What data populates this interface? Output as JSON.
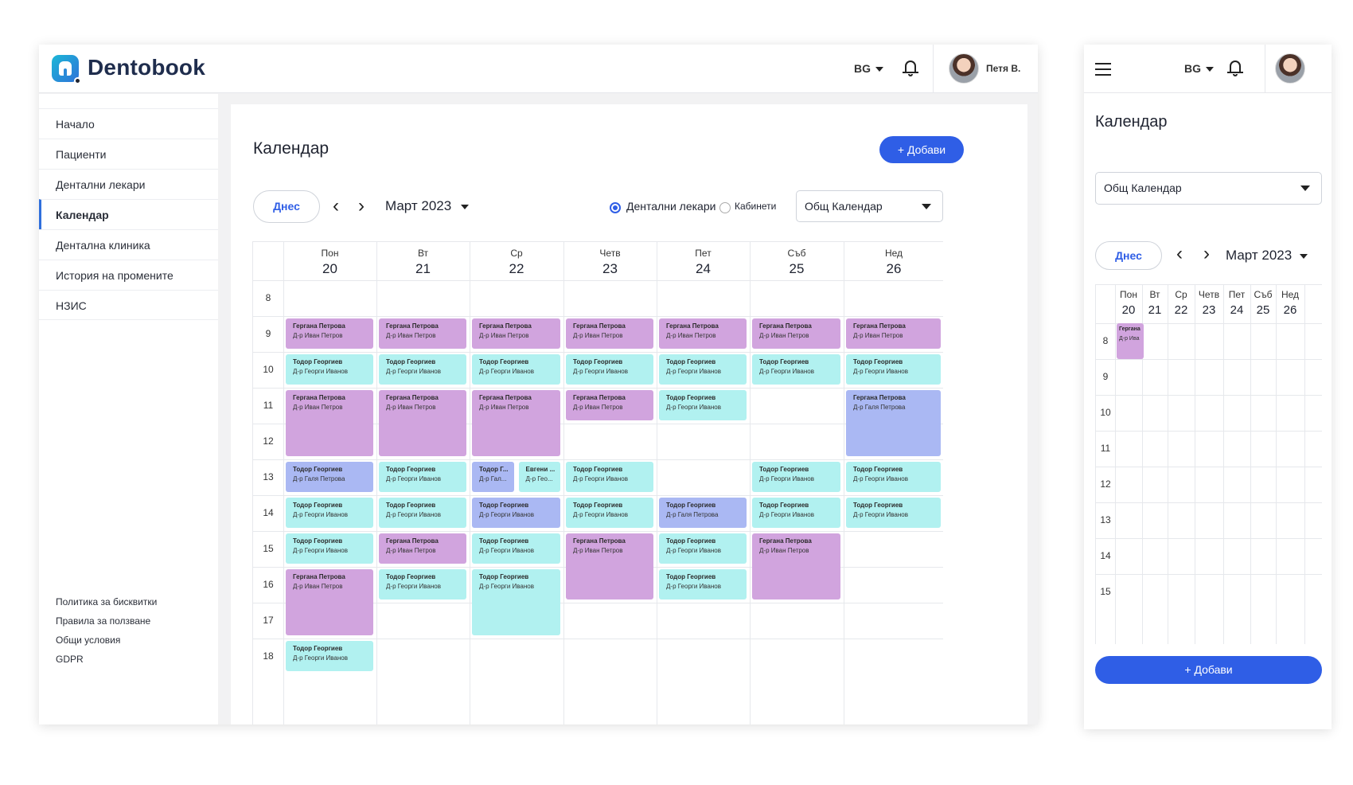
{
  "brand": {
    "name": "Dentobook",
    "accent": "#2f5ee6"
  },
  "header": {
    "lang": "BG",
    "user": "Петя В.",
    "icons": [
      "bell-icon",
      "avatar"
    ]
  },
  "sidebar": {
    "items": [
      {
        "label": "Начало"
      },
      {
        "label": "Пациенти"
      },
      {
        "label": "Дентални лекари"
      },
      {
        "label": "Календар",
        "active": true
      },
      {
        "label": "Дентална клиника"
      },
      {
        "label": "История на промените"
      },
      {
        "label": "НЗИС"
      }
    ],
    "footer": [
      "Политика за бисквитки",
      "Правила за ползване",
      "Общи условия",
      "GDPR"
    ]
  },
  "page": {
    "title": "Календар",
    "add_label": "+ Добави",
    "today_label": "Днес",
    "month": "Март 2023",
    "radio_dentists": "Дентални лекари",
    "radio_rooms": "Кабинети",
    "calendar_select": "Общ Календар"
  },
  "calendar": {
    "days": [
      {
        "name": "Пон",
        "date": "20"
      },
      {
        "name": "Вт",
        "date": "21"
      },
      {
        "name": "Ср",
        "date": "22"
      },
      {
        "name": "Четв",
        "date": "23"
      },
      {
        "name": "Пет",
        "date": "24"
      },
      {
        "name": "Съб",
        "date": "25"
      },
      {
        "name": "Нед",
        "date": "26"
      }
    ],
    "hours": [
      "8",
      "9",
      "10",
      "11",
      "12",
      "13",
      "14",
      "15",
      "16",
      "17",
      "18"
    ],
    "colors": {
      "purple": "#d1a4de",
      "cyan": "#b1f1f0",
      "blue": "#aab8f3"
    },
    "events": [
      {
        "day": 0,
        "start": 9,
        "end": 10,
        "patient": "Гергана Петрова",
        "doctor": "Д-р Иван Петров",
        "color": "purple"
      },
      {
        "day": 0,
        "start": 10,
        "end": 11,
        "patient": "Тодор Георгиев",
        "doctor": "Д-р Георги Иванов",
        "color": "cyan"
      },
      {
        "day": 0,
        "start": 11,
        "end": 13,
        "patient": "Гергана Петрова",
        "doctor": "Д-р Иван Петров",
        "color": "purple"
      },
      {
        "day": 0,
        "start": 13,
        "end": 14,
        "patient": "Тодор Георгиев",
        "doctor": "Д-р Галя Петрова",
        "color": "blue"
      },
      {
        "day": 0,
        "start": 14,
        "end": 15,
        "patient": "Тодор Георгиев",
        "doctor": "Д-р Георги Иванов",
        "color": "cyan"
      },
      {
        "day": 0,
        "start": 15,
        "end": 16,
        "patient": "Тодор Георгиев",
        "doctor": "Д-р Георги Иванов",
        "color": "cyan"
      },
      {
        "day": 0,
        "start": 16,
        "end": 18,
        "patient": "Гергана Петрова",
        "doctor": "Д-р Иван Петров",
        "color": "purple"
      },
      {
        "day": 0,
        "start": 18,
        "end": 19,
        "patient": "Тодор Георгиев",
        "doctor": "Д-р Георги Иванов",
        "color": "cyan"
      },
      {
        "day": 1,
        "start": 9,
        "end": 10,
        "patient": "Гергана Петрова",
        "doctor": "Д-р Иван Петров",
        "color": "purple"
      },
      {
        "day": 1,
        "start": 10,
        "end": 11,
        "patient": "Тодор Георгиев",
        "doctor": "Д-р Георги Иванов",
        "color": "cyan"
      },
      {
        "day": 1,
        "start": 11,
        "end": 13,
        "patient": "Гергана Петрова",
        "doctor": "Д-р Иван Петров",
        "color": "purple"
      },
      {
        "day": 1,
        "start": 13,
        "end": 14,
        "patient": "Тодор Георгиев",
        "doctor": "Д-р Георги Иванов",
        "color": "cyan"
      },
      {
        "day": 1,
        "start": 14,
        "end": 15,
        "patient": "Тодор Георгиев",
        "doctor": "Д-р Георги Иванов",
        "color": "cyan"
      },
      {
        "day": 1,
        "start": 15,
        "end": 16,
        "patient": "Гергана Петрова",
        "doctor": "Д-р Иван Петров",
        "color": "purple"
      },
      {
        "day": 1,
        "start": 16,
        "end": 17,
        "patient": "Тодор Георгиев",
        "doctor": "Д-р Георги Иванов",
        "color": "cyan"
      },
      {
        "day": 2,
        "start": 9,
        "end": 10,
        "patient": "Гергана Петрова",
        "doctor": "Д-р Иван Петров",
        "color": "purple"
      },
      {
        "day": 2,
        "start": 10,
        "end": 11,
        "patient": "Тодор Георгиев",
        "doctor": "Д-р Георги Иванов",
        "color": "cyan"
      },
      {
        "day": 2,
        "start": 11,
        "end": 13,
        "patient": "Гергана Петрова",
        "doctor": "Д-р Иван Петров",
        "color": "purple"
      },
      {
        "day": 2,
        "start": 13,
        "end": 14,
        "patient": "Тодор Г...",
        "doctor": "Д-р Гал...",
        "color": "blue",
        "half": 0
      },
      {
        "day": 2,
        "start": 13,
        "end": 14,
        "patient": "Евгени ...",
        "doctor": "Д-р Гео...",
        "color": "cyan",
        "half": 1
      },
      {
        "day": 2,
        "start": 14,
        "end": 15,
        "patient": "Тодор Георгиев",
        "doctor": "Д-р Георги Иванов",
        "color": "blue"
      },
      {
        "day": 2,
        "start": 15,
        "end": 16,
        "patient": "Тодор Георгиев",
        "doctor": "Д-р Георги Иванов",
        "color": "cyan"
      },
      {
        "day": 2,
        "start": 16,
        "end": 18,
        "patient": "Тодор Георгиев",
        "doctor": "Д-р Георги Иванов",
        "color": "cyan"
      },
      {
        "day": 3,
        "start": 9,
        "end": 10,
        "patient": "Гергана Петрова",
        "doctor": "Д-р Иван Петров",
        "color": "purple"
      },
      {
        "day": 3,
        "start": 10,
        "end": 11,
        "patient": "Тодор Георгиев",
        "doctor": "Д-р Георги Иванов",
        "color": "cyan"
      },
      {
        "day": 3,
        "start": 11,
        "end": 12,
        "patient": "Гергана Петрова",
        "doctor": "Д-р Иван Петров",
        "color": "purple"
      },
      {
        "day": 3,
        "start": 13,
        "end": 14,
        "patient": "Тодор Георгиев",
        "doctor": "Д-р Георги Иванов",
        "color": "cyan"
      },
      {
        "day": 3,
        "start": 14,
        "end": 15,
        "patient": "Тодор Георгиев",
        "doctor": "Д-р Георги Иванов",
        "color": "cyan"
      },
      {
        "day": 3,
        "start": 15,
        "end": 17,
        "patient": "Гергана Петрова",
        "doctor": "Д-р Иван Петров",
        "color": "purple"
      },
      {
        "day": 4,
        "start": 9,
        "end": 10,
        "patient": "Гергана Петрова",
        "doctor": "Д-р Иван Петров",
        "color": "purple"
      },
      {
        "day": 4,
        "start": 10,
        "end": 11,
        "patient": "Тодор Георгиев",
        "doctor": "Д-р Георги Иванов",
        "color": "cyan"
      },
      {
        "day": 4,
        "start": 11,
        "end": 12,
        "patient": "Тодор Георгиев",
        "doctor": "Д-р Георги Иванов",
        "color": "cyan"
      },
      {
        "day": 4,
        "start": 14,
        "end": 15,
        "patient": "Тодор Георгиев",
        "doctor": "Д-р Галя Петрова",
        "color": "blue"
      },
      {
        "day": 4,
        "start": 15,
        "end": 16,
        "patient": "Тодор Георгиев",
        "doctor": "Д-р Георги Иванов",
        "color": "cyan"
      },
      {
        "day": 4,
        "start": 16,
        "end": 17,
        "patient": "Тодор Георгиев",
        "doctor": "Д-р Георги Иванов",
        "color": "cyan"
      },
      {
        "day": 5,
        "start": 9,
        "end": 10,
        "patient": "Гергана Петрова",
        "doctor": "Д-р Иван Петров",
        "color": "purple"
      },
      {
        "day": 5,
        "start": 10,
        "end": 11,
        "patient": "Тодор Георгиев",
        "doctor": "Д-р Георги Иванов",
        "color": "cyan"
      },
      {
        "day": 5,
        "start": 13,
        "end": 14,
        "patient": "Тодор Георгиев",
        "doctor": "Д-р Георги Иванов",
        "color": "cyan"
      },
      {
        "day": 5,
        "start": 14,
        "end": 15,
        "patient": "Тодор Георгиев",
        "doctor": "Д-р Георги Иванов",
        "color": "cyan"
      },
      {
        "day": 5,
        "start": 15,
        "end": 17,
        "patient": "Гергана Петрова",
        "doctor": "Д-р Иван Петров",
        "color": "purple"
      },
      {
        "day": 6,
        "start": 9,
        "end": 10,
        "patient": "Гергана Петрова",
        "doctor": "Д-р Иван Петров",
        "color": "purple"
      },
      {
        "day": 6,
        "start": 10,
        "end": 11,
        "patient": "Тодор Георгиев",
        "doctor": "Д-р Георги Иванов",
        "color": "cyan"
      },
      {
        "day": 6,
        "start": 11,
        "end": 13,
        "patient": "Гергана Петрова",
        "doctor": "Д-р Галя Петрова",
        "color": "blue"
      },
      {
        "day": 6,
        "start": 13,
        "end": 14,
        "patient": "Тодор Георгиев",
        "doctor": "Д-р Георги Иванов",
        "color": "cyan"
      },
      {
        "day": 6,
        "start": 14,
        "end": 15,
        "patient": "Тодор Георгиев",
        "doctor": "Д-р Георги Иванов",
        "color": "cyan"
      }
    ]
  },
  "mobile": {
    "title": "Календар",
    "calendar_select": "Общ Календар",
    "today_label": "Днес",
    "month": "Март 2023",
    "add_label": "+ Добави",
    "lang": "BG",
    "hours": [
      "8",
      "9",
      "10",
      "11",
      "12",
      "13",
      "14",
      "15"
    ],
    "event": {
      "patient": "Гергана",
      "doctor": "Д-р Ива"
    }
  }
}
